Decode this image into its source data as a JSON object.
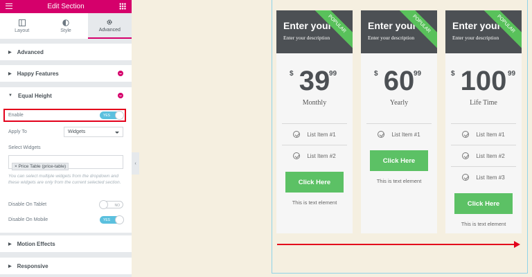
{
  "editor": {
    "title": "Edit Section",
    "tabs": [
      {
        "label": "Layout",
        "icon": "layout-icon"
      },
      {
        "label": "Style",
        "icon": "half-circle-icon"
      },
      {
        "label": "Advanced",
        "icon": "gear-icon",
        "active": true
      }
    ],
    "sections": {
      "advanced": "Advanced",
      "happy_features": "Happy Features",
      "equal_height": "Equal Height",
      "motion_effects": "Motion Effects",
      "responsive": "Responsive"
    },
    "equal_height": {
      "enable_label": "Enable",
      "enable_state": "YES",
      "apply_to_label": "Apply To",
      "apply_to_value": "Widgets",
      "select_widgets_label": "Select Widgets",
      "selected_widget": "× Price Table (price-table)",
      "help_text": "You can select multiple widgets from the dropdown and these widgets are only from the current selected section.",
      "tablet_label": "Disable On Tablet",
      "tablet_state": "NO",
      "mobile_label": "Disable On Mobile",
      "mobile_state": "YES"
    },
    "accent_color": "#d5006b"
  },
  "pricing": {
    "ribbon": "POPULAR",
    "cards": [
      {
        "title": "Enter your ti",
        "description": "Enter your description",
        "currency": "$",
        "amount": "39",
        "cents": "99",
        "period": "Monthly",
        "items": [
          "List Item #1",
          "List Item #2"
        ],
        "button": "Click Here",
        "note": "This is text element"
      },
      {
        "title": "Enter your ti",
        "description": "Enter your description",
        "currency": "$",
        "amount": "60",
        "cents": "99",
        "period": "Yearly",
        "items": [
          "List Item #1"
        ],
        "button": "Click Here",
        "note": "This is text element"
      },
      {
        "title": "Enter your ti",
        "description": "Enter your description",
        "currency": "$",
        "amount": "100",
        "cents": "99",
        "period": "Life Time",
        "items": [
          "List Item #1",
          "List Item #2",
          "List Item #3"
        ],
        "button": "Click Here",
        "note": "This is text element"
      }
    ],
    "button_color": "#5cc165",
    "header_color": "#4c5054"
  }
}
